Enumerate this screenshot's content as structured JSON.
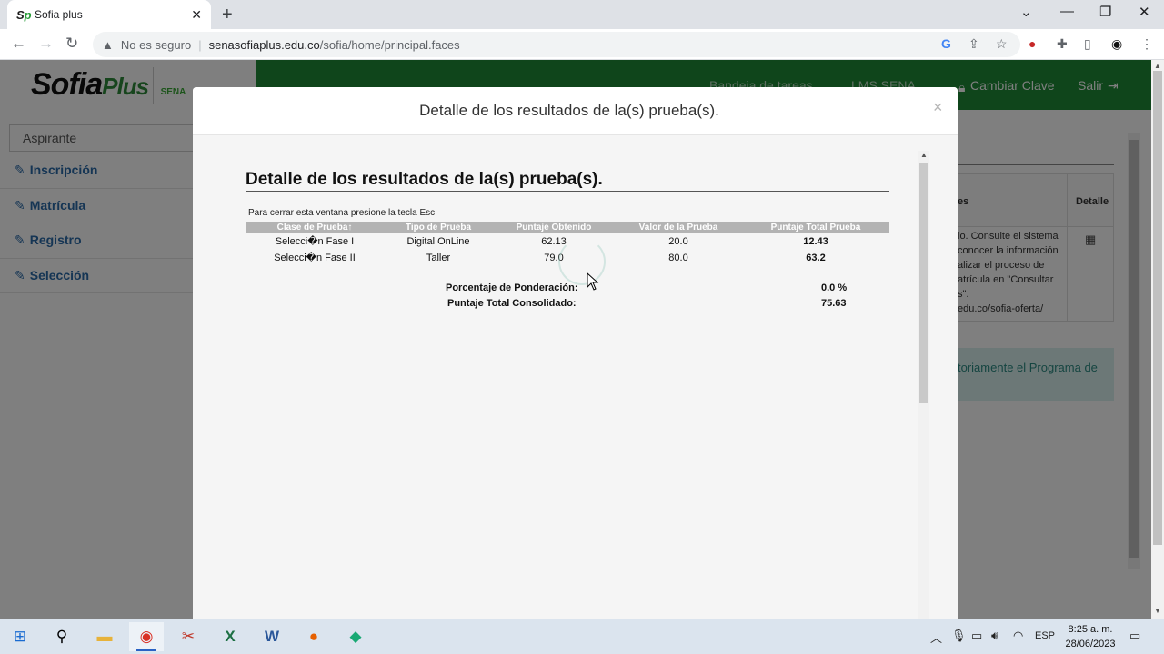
{
  "browser": {
    "tab_title": "Sofia plus",
    "tab_close": "✕",
    "new_tab": "+",
    "security_label": "No es seguro",
    "url_host": "senasofiaplus.edu.co",
    "url_path": "/sofia/home/principal.faces",
    "icons": [
      "back-arrow-icon",
      "forward-arrow-icon",
      "reload-icon",
      "warning-icon",
      "google-icon",
      "share-icon",
      "bookmark-star-icon",
      "extension-abp-icon",
      "puzzle-icon",
      "side-panel-icon",
      "profile-icon",
      "kebab-menu-icon"
    ]
  },
  "site": {
    "logo_main": "Sofia",
    "logo_accent": "Plus",
    "logo_sena": "SENA",
    "header_links": {
      "bandeja": "Bandeja de tareas",
      "lms": "LMS SENA",
      "cambiar_clave": "Cambiar Clave",
      "salir": "Salir"
    },
    "sidebar_role": "Aspirante",
    "sidebar_items": [
      "Inscripción",
      "Matrícula",
      "Registro",
      "Selección"
    ],
    "right_panel": {
      "header_col1": "es",
      "header_col2": "Detalle",
      "lines": [
        "lo. Consulte el sistema",
        "conocer la información",
        "alizar el proceso de",
        "atrícula en \"Consultar",
        "s\".",
        "edu.co/sofia-oferta/"
      ],
      "alert": "toriamente el Programa de"
    }
  },
  "modal": {
    "title": "Detalle de los resultados de la(s) prueba(s).",
    "close": "×",
    "heading": "Detalle de los resultados de la(s) prueba(s).",
    "esc_note": "Para cerrar esta ventana presione la tecla Esc.",
    "columns": [
      "Clase de Prueba↑",
      "Tipo de Prueba",
      "Puntaje Obtenido",
      "Valor de la Prueba",
      "Puntaje Total Prueba"
    ],
    "rows": [
      [
        "Selecci�n Fase I",
        "Digital OnLine",
        "62.13",
        "20.0",
        "12.43"
      ],
      [
        "Selecci�n Fase II",
        "Taller",
        "79.0",
        "80.0",
        "63.2"
      ]
    ],
    "ponderacion_label": "Porcentaje de Ponderación:",
    "ponderacion_value": "0.0 %",
    "consolidado_label": "Puntaje Total Consolidado:",
    "consolidado_value": "75.63"
  },
  "taskbar": {
    "lang": "ESP",
    "time": "8:25 a. m.",
    "date": "28/06/2023",
    "apps": [
      "windows-start-icon",
      "search-icon",
      "file-explorer-icon",
      "chrome-icon",
      "snipping-tool-icon",
      "excel-icon",
      "word-icon",
      "firefox-icon",
      "app-icon"
    ]
  }
}
